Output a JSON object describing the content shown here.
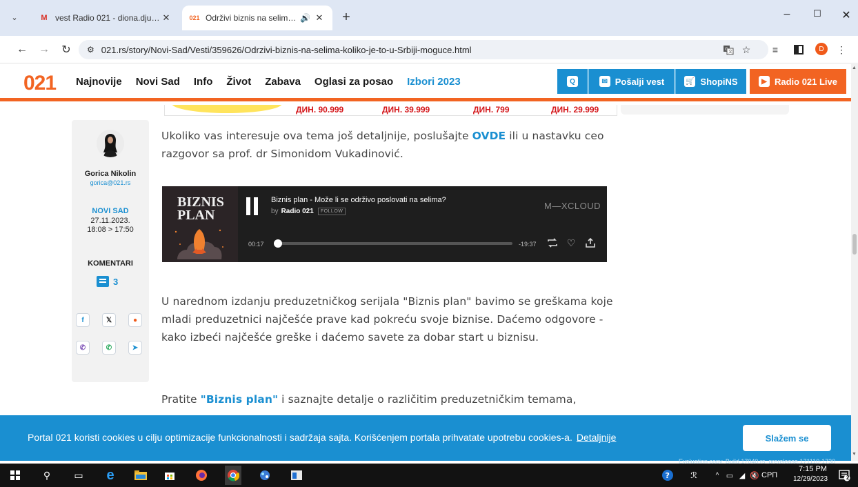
{
  "browser": {
    "tabs": [
      {
        "title": "vest Radio 021 - diona.djurdjev",
        "favicon": "M",
        "active": false
      },
      {
        "title": "Održivi biznis na selima - ko",
        "favicon": "021",
        "active": true
      }
    ],
    "new_tab_symbol": "+",
    "window_controls": {
      "minimize": "–",
      "maximize": "☐",
      "close": "✕"
    },
    "url": "021.rs/story/Novi-Sad/Vesti/359626/Odrzivi-biznis-na-selima-koliko-je-to-u-Srbiji-moguce.html",
    "profile_initial": "D"
  },
  "header": {
    "logo": "021",
    "nav": [
      "Najnovije",
      "Novi Sad",
      "Info",
      "Život",
      "Zabava",
      "Oglasi za posao",
      "Izbori 2023"
    ],
    "search_label": "Q",
    "posalji_label": "Pošalji vest",
    "shop_label": "ShopiNS",
    "radio_label": "Radio 021 Live"
  },
  "ad": {
    "prices": [
      "ДИН. 90.999",
      "ДИН. 39.999",
      "ДИН. 799",
      "ДИН. 29.999"
    ]
  },
  "sidebar": {
    "author_name": "Gorica Nikolin",
    "author_email": "gorica@021.rs",
    "location": "NOVI SAD",
    "date": "27.11.2023.",
    "time": "18:08 > 17:50",
    "comments_label": "KOMENTARI",
    "comments_count": "3",
    "share_icons": [
      "facebook-icon",
      "x-icon",
      "reddit-icon",
      "viber-icon",
      "whatsapp-icon",
      "telegram-icon"
    ]
  },
  "article": {
    "p1_before": "Ukoliko vas interesuje ova tema još detaljnije, poslušajte ",
    "p1_link": "OVDE",
    "p1_after": " ili u nastavku ceo razgovor sa prof. dr Simonidom Vukadinović.",
    "p2": "U narednom izdanju preduzetničkog serijala \"Biznis plan\" bavimo se greškama koje mladi preduzetnici najčešće prave kad pokreću svoje biznise. Daćemo odgovore - kako izbeći najčešće greške i daćemo savete za dobar start u biznisu.",
    "p3_before": "Pratite ",
    "p3_link": "\"Biznis plan\"",
    "p3_after": " i saznajte detalje o različitim preduzetničkim temama,"
  },
  "player": {
    "cover_title_1": "BIZNIS",
    "cover_title_2": "PLAN",
    "title": "Biznis plan - Može li se održivo poslovati na selima?",
    "by_prefix": "by",
    "artist": "Radio 021",
    "follow_label": "FOLLOW",
    "brand": "M—XCLOUD",
    "current_time": "00:17",
    "remaining_time": "-19:37",
    "progress_fraction": 0.014
  },
  "cookie": {
    "text": "Portal 021 koristi cookies u cilju optimizacije funkcionalnosti i sadržaja sajta. Korišćenjem portala prihvatate upotrebu cookies-a.",
    "link": "Detaljnije",
    "button": "Slažem se"
  },
  "watermark": "Evaluation copy. Build 17040.rs_prerelease.171110-1730",
  "taskbar": {
    "language": "СРП",
    "time": "7:15 PM",
    "date": "12/29/2023",
    "notifications": "2"
  },
  "colors": {
    "brand_orange": "#f26422",
    "brand_blue": "#1a8fd1"
  }
}
